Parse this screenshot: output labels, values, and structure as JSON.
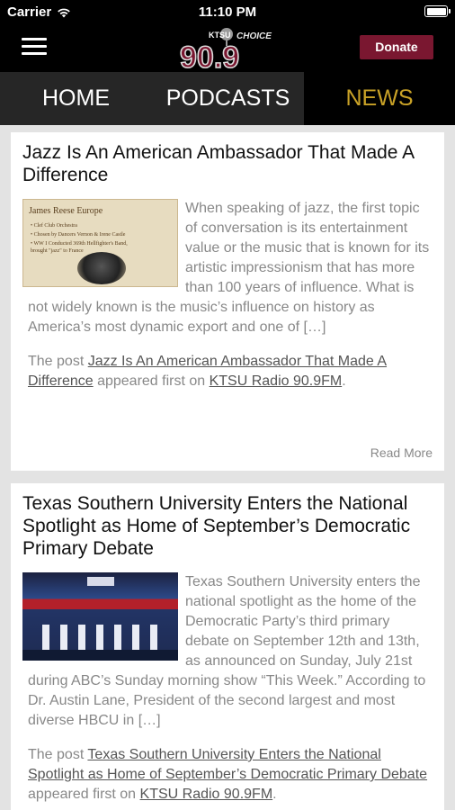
{
  "status_bar": {
    "carrier": "Carrier",
    "time": "11:10 PM"
  },
  "header": {
    "logo_text_top": "KTSU",
    "logo_text_choice": "CHOICE",
    "logo_text_freq": "90.9",
    "donate_label": "Donate",
    "brand_color": "#7a1730",
    "accent_color": "#c9a227"
  },
  "tabs": [
    {
      "label": "HOME",
      "active": false
    },
    {
      "label": "PODCASTS",
      "active": false
    },
    {
      "label": "NEWS",
      "active": true
    }
  ],
  "articles": [
    {
      "title": "Jazz Is An American Ambassador That Made A Difference",
      "thumb_title": "James Reese Europe",
      "thumb_lines": [
        "• Clef Club Orchestra",
        "• Chosen by Dancers Vernon & Irene Castle",
        "• WW I Conducted 369th Hellfighter's Band,",
        "  brought \"jazz\" to France"
      ],
      "excerpt": "When speaking of jazz, the first topic of conversation is its entertainment value or the music that is known for its artistic impressionism that has more than 100 years of influence. What is not widely known is the music’s influence on history as America’s most dynamic export and one of […]",
      "note_prefix": "The post ",
      "note_link": "Jazz Is An American Ambassador That Made A Difference",
      "note_middle": " appeared first on ",
      "note_site": "KTSU Radio 90.9FM",
      "note_suffix": ".",
      "read_more": "Read More"
    },
    {
      "title": "Texas Southern University Enters the National Spotlight as Home of September’s Democratic Primary Debate",
      "excerpt": "Texas Southern University enters the national spotlight as the home of the Democratic Party’s third primary debate on September 12th and 13th, as announced on Sunday, July 21st during ABC’s Sunday morning show “This Week.” According to Dr. Austin Lane, President of the second largest and most diverse HBCU in […]",
      "note_prefix": "The post ",
      "note_link": "Texas Southern University Enters the National Spotlight as Home of September’s Democratic Primary Debate",
      "note_middle": " appeared first on ",
      "note_site": "KTSU Radio 90.9FM",
      "note_suffix": "."
    }
  ]
}
